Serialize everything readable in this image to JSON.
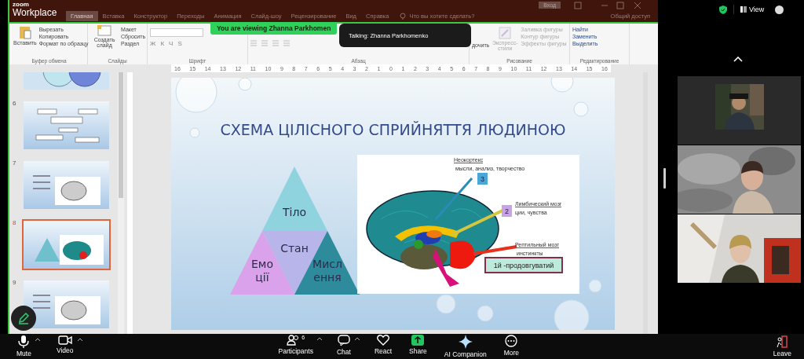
{
  "zoom_logo": {
    "brand": "zoom",
    "product": "Workplace"
  },
  "powerpoint": {
    "tabs": [
      {
        "label": "Главная",
        "selected": true
      },
      {
        "label": "Вставка",
        "selected": false
      },
      {
        "label": "Конструктор",
        "selected": false
      },
      {
        "label": "Переходы",
        "selected": false
      },
      {
        "label": "Анимация",
        "selected": false
      },
      {
        "label": "Слайд-шоу",
        "selected": false
      },
      {
        "label": "Рецензирование",
        "selected": false
      },
      {
        "label": "Вид",
        "selected": false
      },
      {
        "label": "Справка",
        "selected": false
      }
    ],
    "tell_me": "Что вы хотите сделать?",
    "sign_in": "Вход",
    "share": "Общий доступ",
    "clipboard": {
      "label": "Буфер обмена",
      "paste": "Вставить",
      "items": [
        "Вырезать",
        "Копировать",
        "Формат по образцу"
      ]
    },
    "slides_group": {
      "label": "Слайды",
      "new_slide": "Создать слайд",
      "items": [
        "Макет",
        "Сбросить",
        "Раздел"
      ]
    },
    "font": {
      "label": "Шрифт",
      "buttons": [
        "Ж",
        "К",
        "Ч",
        "S"
      ]
    },
    "paragraph": {
      "label": "Абзац"
    },
    "drawing": {
      "label": "Рисование",
      "arrange": "дочить",
      "styles": "Экспресс-стили",
      "items": [
        "Заливка фигуры",
        "Контур фигуры",
        "Эффекты фигуры"
      ]
    },
    "editing": {
      "label": "Редактирование",
      "items": [
        "Найти",
        "Заменить",
        "Выделить"
      ]
    },
    "ruler": [
      "16",
      "15",
      "14",
      "13",
      "12",
      "11",
      "10",
      "9",
      "8",
      "7",
      "6",
      "5",
      "4",
      "3",
      "2",
      "1",
      "0",
      "1",
      "2",
      "3",
      "4",
      "5",
      "6",
      "7",
      "8",
      "9",
      "10",
      "11",
      "12",
      "13",
      "14",
      "15",
      "16"
    ]
  },
  "viewing_banner": "You are viewing  Zhanna Parkhomen",
  "talking": "Talking: Zhanna Parkhomenko",
  "thumbnails": [
    {
      "number": "6",
      "selected": false
    },
    {
      "number": "7",
      "selected": false
    },
    {
      "number": "8",
      "selected": true
    },
    {
      "number": "9",
      "selected": false
    }
  ],
  "slide": {
    "title": "СХЕМА ЦІЛІСНОГО СПРИЙНЯТТЯ ЛЮДИНОЮ",
    "pyramid": [
      {
        "lines": [
          "Тіло"
        ],
        "color": "#8fd3de"
      },
      {
        "lines": [
          "Стан"
        ],
        "color": "#b8b5ea"
      },
      {
        "lines": [
          "Емо",
          "ції"
        ],
        "color": "#d9a2ea"
      },
      {
        "lines": [
          "Мисл",
          "ення"
        ],
        "color": "#2e8b9c"
      }
    ],
    "labels": [
      {
        "title": "Неокортекс",
        "note": "мысли, анализ, творчество",
        "badge": "3",
        "color": "#4aa6d6"
      },
      {
        "title": "Лимбический мозг",
        "note": "ции, чувства",
        "badge": "2",
        "color": "#c9a3ea"
      },
      {
        "title": "Рептильный мозг",
        "note": "инстинкты"
      }
    ],
    "caption": "1й -продовгуватий"
  },
  "right_panel": {
    "view": "View"
  },
  "toolbar": [
    {
      "label": "Mute",
      "kind": "mic",
      "caret": true
    },
    {
      "label": "Video",
      "kind": "video",
      "caret": true
    },
    {
      "label": "Participants",
      "kind": "participants",
      "count": "6",
      "caret": true
    },
    {
      "label": "Chat",
      "kind": "chat",
      "caret": true
    },
    {
      "label": "React",
      "kind": "react"
    },
    {
      "label": "Share",
      "kind": "share"
    },
    {
      "label": "AI Companion",
      "kind": "ai"
    },
    {
      "label": "More",
      "kind": "more"
    }
  ],
  "leave": "Leave"
}
